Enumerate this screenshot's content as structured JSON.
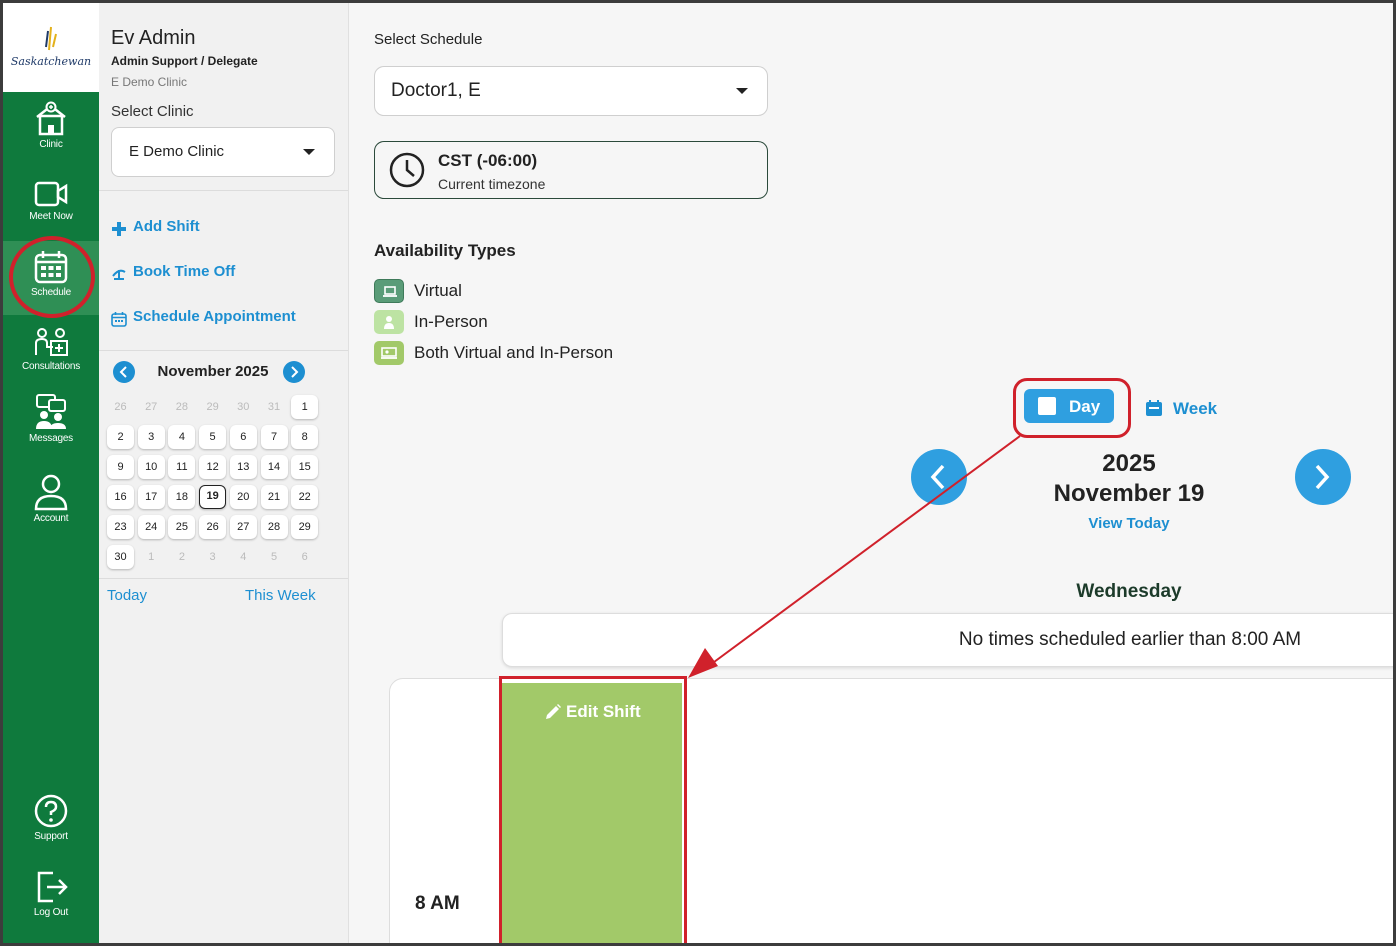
{
  "brand": {
    "logo_text": "Saskatchewan"
  },
  "nav": {
    "items": [
      {
        "label": "Clinic",
        "icon": "clinic-icon"
      },
      {
        "label": "Meet Now",
        "icon": "video-camera-icon"
      },
      {
        "label": "Schedule",
        "icon": "calendar-icon",
        "active": true
      },
      {
        "label": "Consultations",
        "icon": "consultations-icon"
      },
      {
        "label": "Messages",
        "icon": "messages-icon"
      },
      {
        "label": "Account",
        "icon": "user-icon"
      }
    ],
    "bottom": [
      {
        "label": "Support",
        "icon": "help-icon"
      },
      {
        "label": "Log Out",
        "icon": "logout-icon"
      }
    ]
  },
  "user": {
    "name": "Ev Admin",
    "role": "Admin Support / Delegate",
    "clinic": "E Demo Clinic"
  },
  "clinic_select": {
    "label": "Select Clinic",
    "value": "E Demo Clinic"
  },
  "actions": {
    "add_shift": "Add Shift",
    "book_time_off": "Book Time Off",
    "schedule_appointment": "Schedule Appointment"
  },
  "mini_calendar": {
    "title": "November 2025",
    "weeks": [
      [
        "26",
        "27",
        "28",
        "29",
        "30",
        "31",
        "1"
      ],
      [
        "2",
        "3",
        "4",
        "5",
        "6",
        "7",
        "8"
      ],
      [
        "9",
        "10",
        "11",
        "12",
        "13",
        "14",
        "15"
      ],
      [
        "16",
        "17",
        "18",
        "19",
        "20",
        "21",
        "22"
      ],
      [
        "23",
        "24",
        "25",
        "26",
        "27",
        "28",
        "29"
      ],
      [
        "30",
        "1",
        "2",
        "3",
        "4",
        "5",
        "6"
      ]
    ],
    "selected": "19",
    "today_link": "Today",
    "this_week_link": "This Week"
  },
  "schedule_select": {
    "label": "Select Schedule",
    "value": "Doctor1, E"
  },
  "timezone": {
    "title": "CST (-06:00)",
    "subtitle": "Current timezone"
  },
  "availability": {
    "title": "Availability Types",
    "types": [
      {
        "label": "Virtual",
        "color": "#5a9c78"
      },
      {
        "label": "In-Person",
        "color": "#bde3a3"
      },
      {
        "label": "Both Virtual and In-Person",
        "color": "#a2c969"
      }
    ]
  },
  "view_toggle": {
    "day": "Day",
    "week": "Week"
  },
  "date": {
    "year": "2025",
    "day": "November 19",
    "view_today": "View Today",
    "weekday": "Wednesday"
  },
  "notice": "No times scheduled earlier than 8:00 AM",
  "grid": {
    "time_label": "8 AM",
    "shift_label": "Edit Shift"
  },
  "colors": {
    "rail": "#0f7a3d",
    "accent": "#2f9fe0",
    "highlight": "#d0212b",
    "shift": "#a2c969"
  }
}
